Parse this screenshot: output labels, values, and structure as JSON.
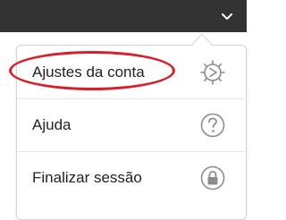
{
  "header": {
    "menu_icon": "chevron-down-icon"
  },
  "menu": {
    "items": [
      {
        "label": "Ajustes da conta",
        "icon": "gear-icon"
      },
      {
        "label": "Ajuda",
        "icon": "help-icon"
      },
      {
        "label": "Finalizar sessão",
        "icon": "lock-icon"
      }
    ]
  },
  "annotation": {
    "highlight_color": "#d8202a"
  }
}
